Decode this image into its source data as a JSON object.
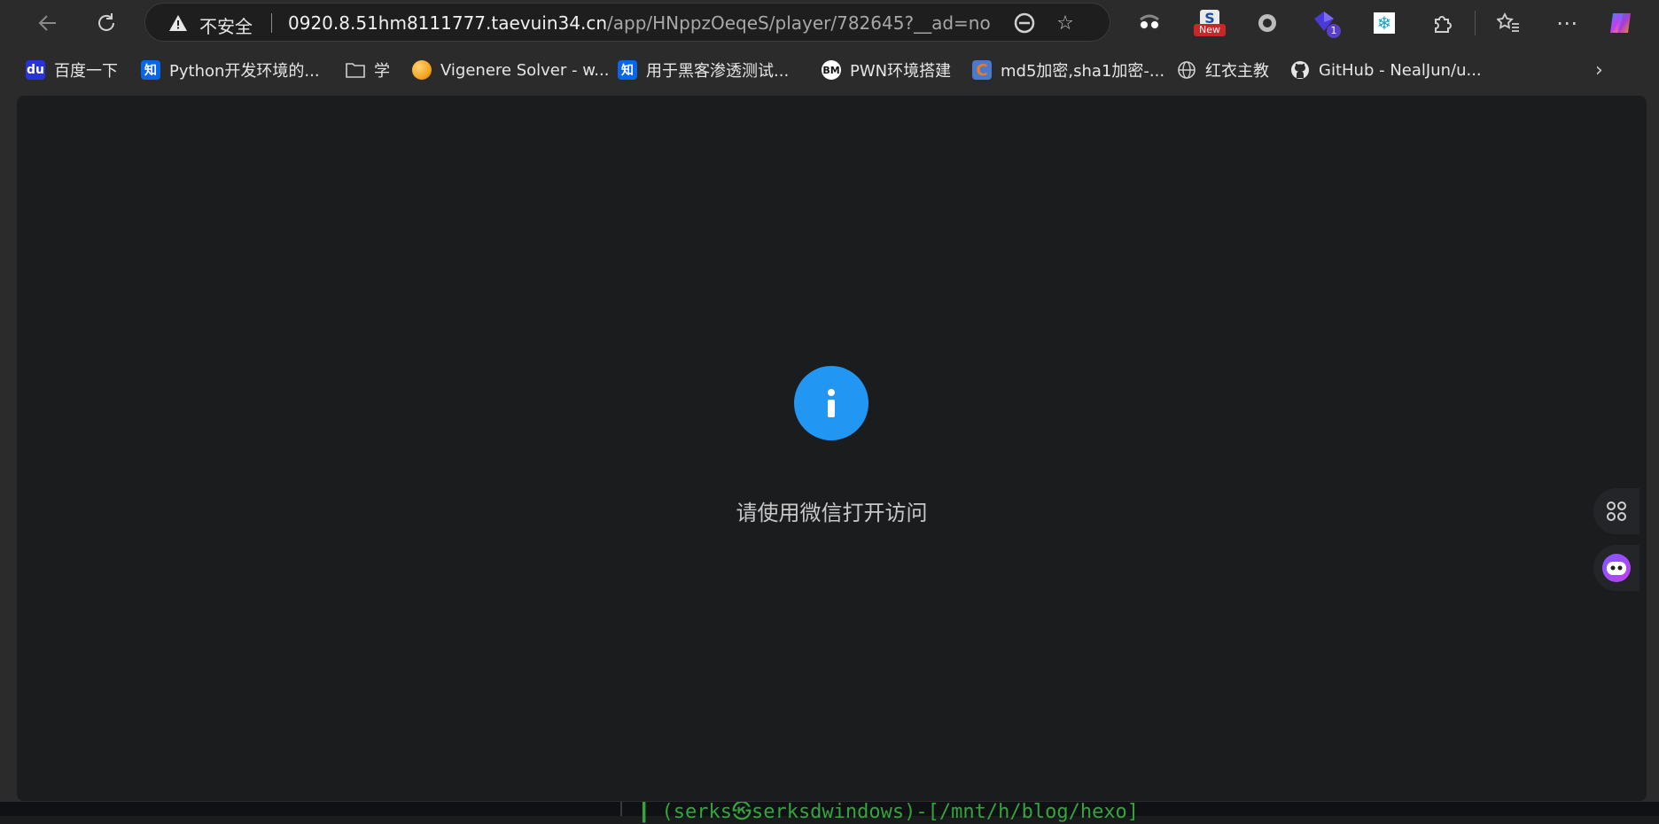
{
  "toolbar": {
    "back_icon": "back-arrow-icon",
    "refresh_icon": "refresh-icon"
  },
  "address_bar": {
    "security_label": "不安全",
    "url_host": "0920.8.51hm8111777.taevuin34.cn",
    "url_path": "/app/HNppzOeqeS/player/782645?__ad=no"
  },
  "extensions": {
    "new_badge": "New",
    "count_badge": "1"
  },
  "bookmarks": [
    {
      "label": "百度一下",
      "icon": "baidu-icon",
      "color": "#2932e1"
    },
    {
      "label": "Python开发环境的...",
      "icon": "zhihu-icon",
      "color": "#0a66e8"
    },
    {
      "label": "学",
      "icon": "folder-icon",
      "color": ""
    },
    {
      "label": "Vigenere Solver - w...",
      "icon": "orange-ball-icon",
      "color": "#f5a623"
    },
    {
      "label": "用于黑客渗透测试...",
      "icon": "zhihu-icon",
      "color": "#0a66e8"
    },
    {
      "label": "PWN环境搭建",
      "icon": "bm-icon",
      "color": "#ffffff"
    },
    {
      "label": "md5加密,sha1加密-...",
      "icon": "c-logo-icon",
      "color": "#e87a2c"
    },
    {
      "label": "红衣主教",
      "icon": "globe-icon",
      "color": ""
    },
    {
      "label": "GitHub - NealJun/u...",
      "icon": "github-icon",
      "color": ""
    }
  ],
  "page": {
    "message": "请使用微信打开访问",
    "info_color": "#2196f3"
  },
  "background_terminal": {
    "text": "┃  (serks㉿serksdwindows)-[/mnt/h/blog/hexo]"
  }
}
